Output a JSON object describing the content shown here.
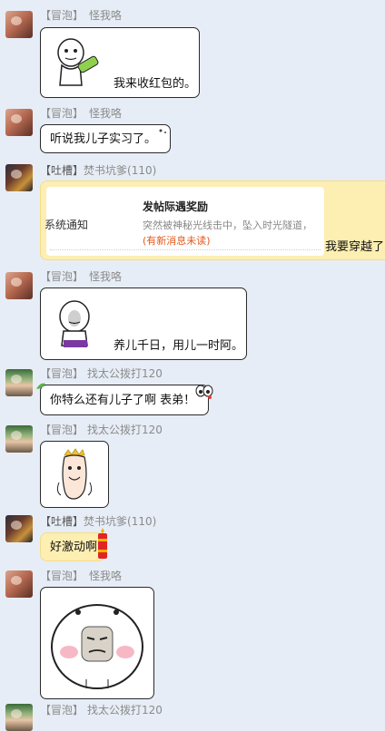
{
  "messages": [
    {
      "tag": "【冒泡】",
      "name": "怪我咯",
      "text": "我来收红包的。"
    },
    {
      "tag": "【冒泡】",
      "name": "怪我咯",
      "text": "听说我儿子实习了。"
    },
    {
      "tag": "【吐槽】",
      "name": "焚书坑爹(110)",
      "card_label": "系统通知",
      "card_title": "发帖际遇奖励",
      "card_desc": "突然被神秘光线击中，坠入时光隧道，",
      "card_link": "(有新消息未读)",
      "text": "我要穿越了"
    },
    {
      "tag": "【冒泡】",
      "name": "怪我咯",
      "text": "养儿千日，用儿一时阿。"
    },
    {
      "tag": "【冒泡】",
      "name": "找太公拨打120",
      "text": "你特么还有儿子了啊 表弟！"
    },
    {
      "tag": "【冒泡】",
      "name": "找太公拨打120"
    },
    {
      "tag": "【吐槽】",
      "name": "焚书坑爹(110)",
      "text": "好激动啊"
    },
    {
      "tag": "【冒泡】",
      "name": "怪我咯"
    },
    {
      "tag": "【冒泡】",
      "name": "找太公拨打120"
    }
  ],
  "colors": {
    "background": "#e7edf6",
    "nick": "#8a8a8a",
    "bubble_border": "#2a2a2a",
    "yellow_bubble": "#fdeeb2",
    "link": "#e2591b"
  }
}
